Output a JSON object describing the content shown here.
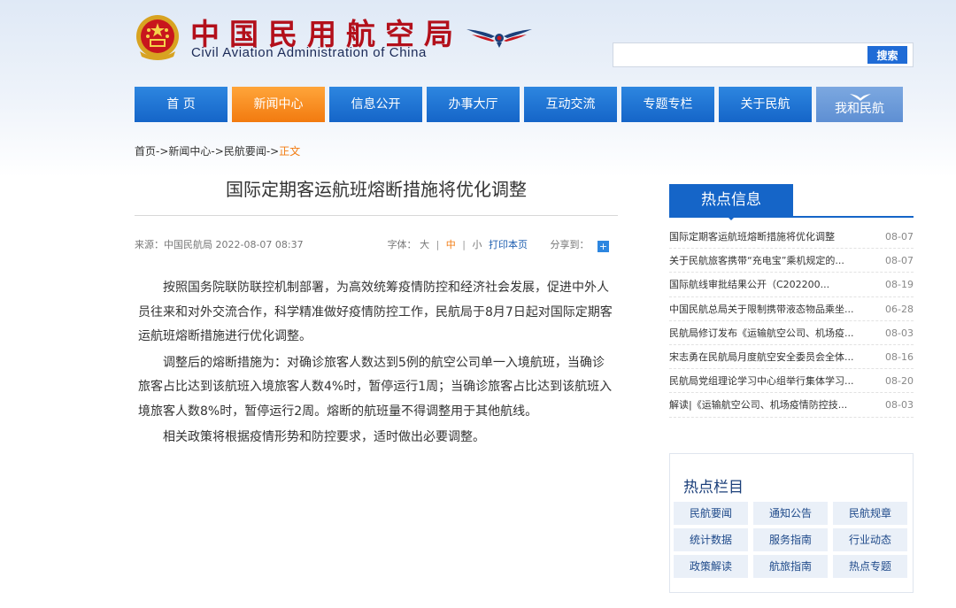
{
  "site": {
    "title_cn": "中国民用航空局",
    "title_en": "Civil Aviation Administration of China"
  },
  "search": {
    "placeholder": "",
    "button": "搜索"
  },
  "nav": [
    {
      "label": "首 页"
    },
    {
      "label": "新闻中心"
    },
    {
      "label": "信息公开"
    },
    {
      "label": "办事大厅"
    },
    {
      "label": "互动交流"
    },
    {
      "label": "专题专栏"
    },
    {
      "label": "关于民航"
    },
    {
      "label": "我和民航"
    }
  ],
  "breadcrumb": {
    "home": "首页",
    "news": "新闻中心",
    "sub": "民航要闻",
    "current": "正文",
    "sep": "->"
  },
  "article": {
    "title": "国际定期客运航班熔断措施将优化调整",
    "source": "来源：中国民航局   2022-08-07 08:37",
    "fontsize_label": "字体：",
    "font_large": "大",
    "font_medium": "中",
    "font_small": "小",
    "print": "打印本页",
    "share_label": "分享到：",
    "share_icon": "+",
    "paragraphs": [
      "按照国务院联防联控机制部署，为高效统筹疫情防控和经济社会发展，促进中外人员往来和对外交流合作，科学精准做好疫情防控工作，民航局于8月7日起对国际定期客运航班熔断措施进行优化调整。",
      "调整后的熔断措施为：对确诊旅客人数达到5例的航空公司单一入境航班，当确诊旅客占比达到该航班入境旅客人数4%时，暂停运行1周；当确诊旅客占比达到该航班入境旅客人数8%时，暂停运行2周。熔断的航班量不得调整用于其他航线。",
      "相关政策将根据疫情形势和防控要求，适时做出必要调整。"
    ]
  },
  "hot_info": {
    "title": "热点信息",
    "items": [
      {
        "text": "国际定期客运航班熔断措施将优化调整",
        "date": "08-07"
      },
      {
        "text": "关于民航旅客携带“充电宝”乘机规定的...",
        "date": "08-07"
      },
      {
        "text": "国际航线审批结果公开（C202200...",
        "date": "08-19"
      },
      {
        "text": "中国民航总局关于限制携带液态物品乘坐...",
        "date": "06-28"
      },
      {
        "text": "民航局修订发布《运输航空公司、机场疫...",
        "date": "08-03"
      },
      {
        "text": "宋志勇在民航局月度航空安全委员会全体...",
        "date": "08-16"
      },
      {
        "text": "民航局党组理论学习中心组举行集体学习...",
        "date": "08-20"
      },
      {
        "text": "解读|《运输航空公司、机场疫情防控技...",
        "date": "08-03"
      }
    ]
  },
  "hot_columns": {
    "title": "热点栏目",
    "items": [
      "民航要闻",
      "通知公告",
      "民航规章",
      "统计数据",
      "服务指南",
      "行业动态",
      "政策解读",
      "航旅指南",
      "热点专题"
    ]
  },
  "colors": {
    "nav_blue": "#1565c8",
    "nav_active": "#f27a0f",
    "logo_red": "#b3101b"
  },
  "icons": {
    "emblem": "national-emblem-icon",
    "wings": "caac-wings-icon",
    "share": "share-plus-icon"
  }
}
